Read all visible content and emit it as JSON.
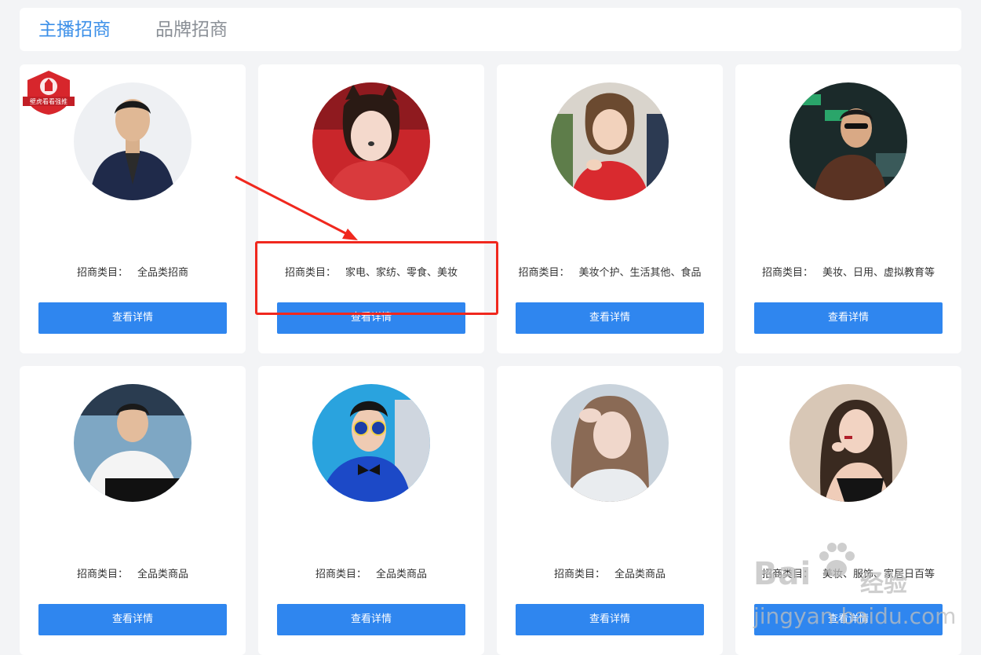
{
  "tabs": {
    "active": "主播招商",
    "inactive": "品牌招商"
  },
  "badge_text": "壁虎看看强推",
  "category_label": "招商类目：",
  "button_label": "查看详情",
  "cards": [
    {
      "categories": "全品类招商"
    },
    {
      "categories": "家电、家纺、零食、美妆"
    },
    {
      "categories": "美妆个护、生活其他、食品"
    },
    {
      "categories": "美妆、日用、虚拟教育等"
    },
    {
      "categories": "全品类商品"
    },
    {
      "categories": "全品类商品"
    },
    {
      "categories": "全品类商品"
    },
    {
      "categories": "美妆、服饰、家居日百等"
    }
  ],
  "watermark": {
    "logo": "Bai",
    "brand": "经验",
    "url": "jingyan.baidu.com"
  },
  "colors": {
    "accent": "#2f86ef",
    "annotation": "#f0281e",
    "tab_active": "#3b8fe8"
  }
}
